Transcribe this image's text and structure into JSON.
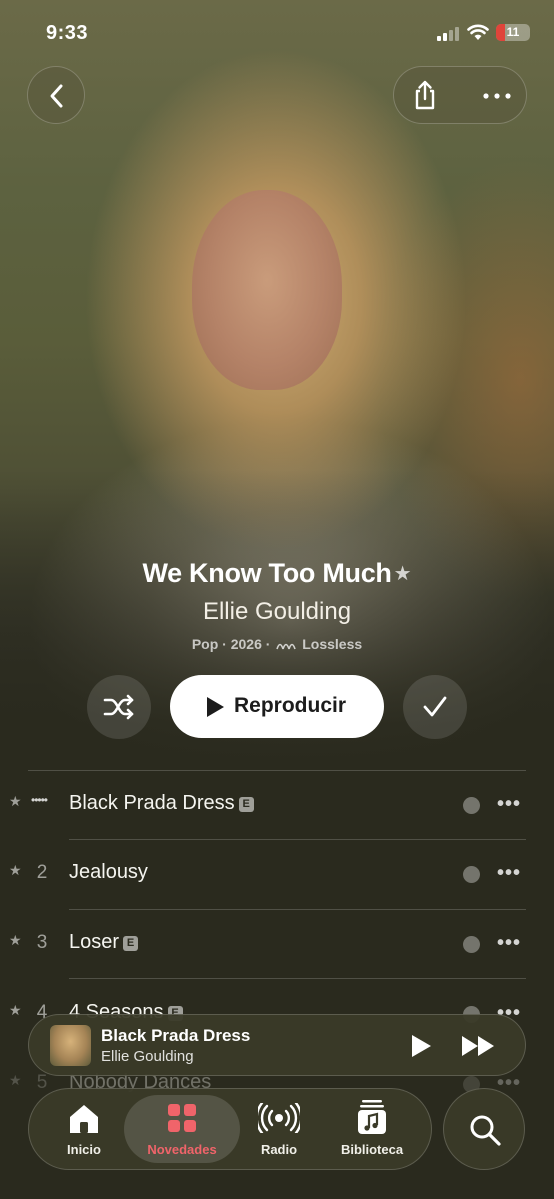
{
  "status_bar": {
    "time": "9:33",
    "battery": "11"
  },
  "album": {
    "title": "We Know Too Much",
    "artist": "Ellie Goulding",
    "genre": "Pop",
    "year": "2026",
    "quality": "Lossless",
    "meta_separator": "·"
  },
  "controls": {
    "play_label": "Reproducir"
  },
  "tracks": [
    {
      "number": "",
      "title": "Black Prada Dress",
      "explicit": "E",
      "playing": true
    },
    {
      "number": "2",
      "title": "Jealousy",
      "explicit": "",
      "playing": false
    },
    {
      "number": "3",
      "title": "Loser",
      "explicit": "E",
      "playing": false
    },
    {
      "number": "4",
      "title": "4 Seasons",
      "explicit": "E",
      "playing": false
    },
    {
      "number": "5",
      "title": "Nobody Dances",
      "explicit": "",
      "playing": false
    }
  ],
  "now_playing": {
    "title": "Black Prada Dress",
    "artist": "Ellie Goulding"
  },
  "tabs": [
    {
      "label": "Inicio",
      "icon": "house-icon",
      "active": false
    },
    {
      "label": "Novedades",
      "icon": "grid-icon",
      "active": true
    },
    {
      "label": "Radio",
      "icon": "radio-waves-icon",
      "active": false
    },
    {
      "label": "Biblioteca",
      "icon": "music-library-icon",
      "active": false
    }
  ],
  "colors": {
    "accent": "#f0646a",
    "background": "#2a2a1e"
  }
}
